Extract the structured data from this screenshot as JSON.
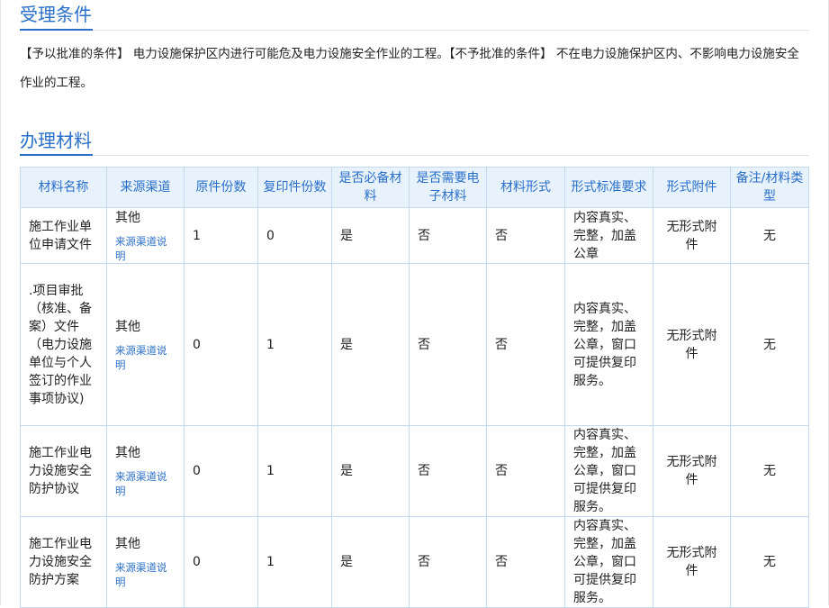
{
  "conditions": {
    "title": "受理条件",
    "text": "【予以批准的条件】 电力设施保护区内进行可能危及电力设施安全作业的工程。【不予批准的条件】 不在电力设施保护区内、不影响电力设施安全作业的工程。"
  },
  "materials": {
    "title": "办理材料",
    "headers": [
      "材料名称",
      "来源渠道",
      "原件份数",
      "复印件份数",
      "是否必备材料",
      "是否需要电子材料",
      "材料形式",
      "形式标准要求",
      "形式附件",
      "备注/材料类型"
    ],
    "rows": [
      {
        "name": "施工作业单位申请文件",
        "source": "其他",
        "source_link": "来源渠道说明",
        "original": "1",
        "copy": "0",
        "required": "是",
        "electronic": "否",
        "form": "否",
        "form_std": "内容真实、完整，加盖公章",
        "attachment": "无形式附件",
        "remark": "无"
      },
      {
        "name": ".项目审批（核准、备案）文件（电力设施单位与个人签订的作业事项协议)",
        "source": "其他",
        "source_link": "来源渠道说明",
        "original": "0",
        "copy": "1",
        "required": "是",
        "electronic": "否",
        "form": "否",
        "form_std": "内容真实、完整，加盖公章，窗口可提供复印服务。",
        "attachment": "无形式附件",
        "remark": "无"
      },
      {
        "name": "施工作业电力设施安全防护协议",
        "source": "其他",
        "source_link": "来源渠道说明",
        "original": "0",
        "copy": "1",
        "required": "是",
        "electronic": "否",
        "form": "否",
        "form_std": "内容真实、完整，加盖公章，窗口可提供复印服务。",
        "attachment": "无形式附件",
        "remark": "无"
      },
      {
        "name": "施工作业电力设施安全防护方案",
        "source": "其他",
        "source_link": "来源渠道说明",
        "original": "0",
        "copy": "1",
        "required": "是",
        "electronic": "否",
        "form": "否",
        "form_std": "内容真实、完整，加盖公章，窗口可提供复印服务。",
        "attachment": "无形式附件",
        "remark": "无"
      }
    ]
  }
}
